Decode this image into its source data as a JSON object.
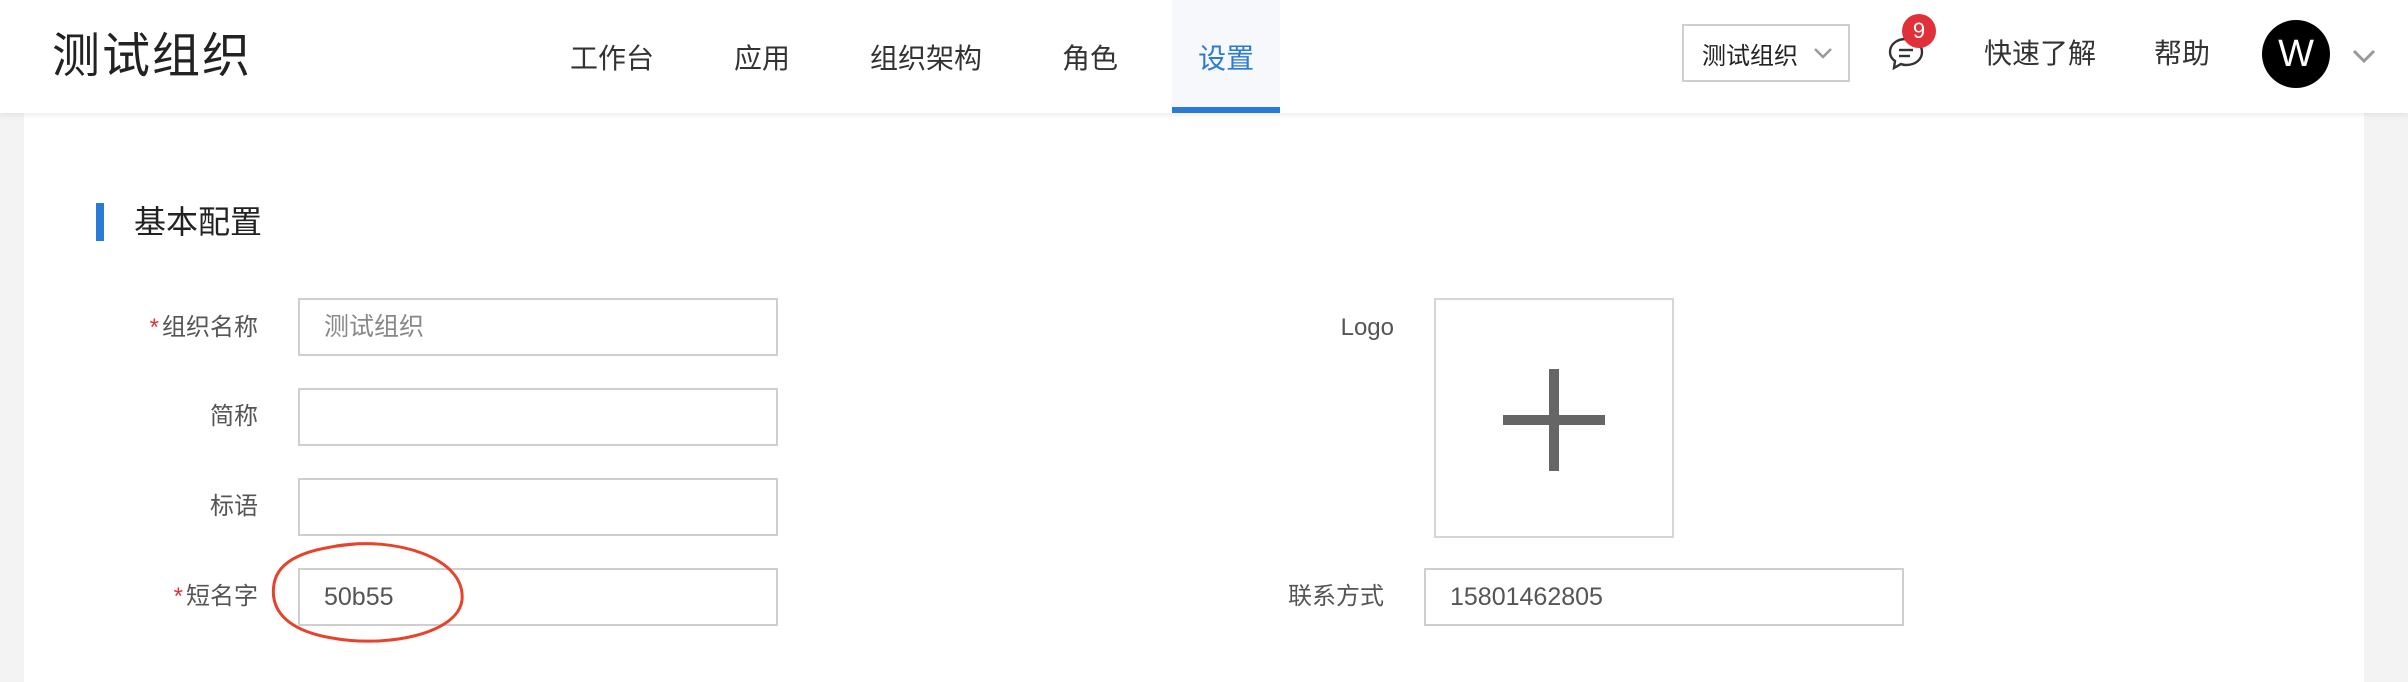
{
  "header": {
    "brand": "测试组织",
    "nav": [
      "工作台",
      "应用",
      "组织架构",
      "角色",
      "设置"
    ],
    "active_nav": "设置",
    "org_select": "测试组织",
    "badge_count": "9",
    "quick_start": "快速了解",
    "help": "帮助",
    "avatar_initial": "W",
    "accent_color": "#2a7ad8",
    "badge_color": "#e0303a"
  },
  "section": {
    "title": "基本配置"
  },
  "form": {
    "required_mark": "*",
    "org_name_label": "组织名称",
    "org_name_value": "测试组织",
    "short_label": "简称",
    "short_value": "",
    "slogan_label": "标语",
    "slogan_value": "",
    "short_name_label": "短名字",
    "short_name_value": "50b55",
    "logo_label": "Logo",
    "contact_label": "联系方式",
    "contact_value": "15801462805"
  },
  "annotation": {
    "color": "#e8432a",
    "shape": "ellipse around short name value"
  }
}
